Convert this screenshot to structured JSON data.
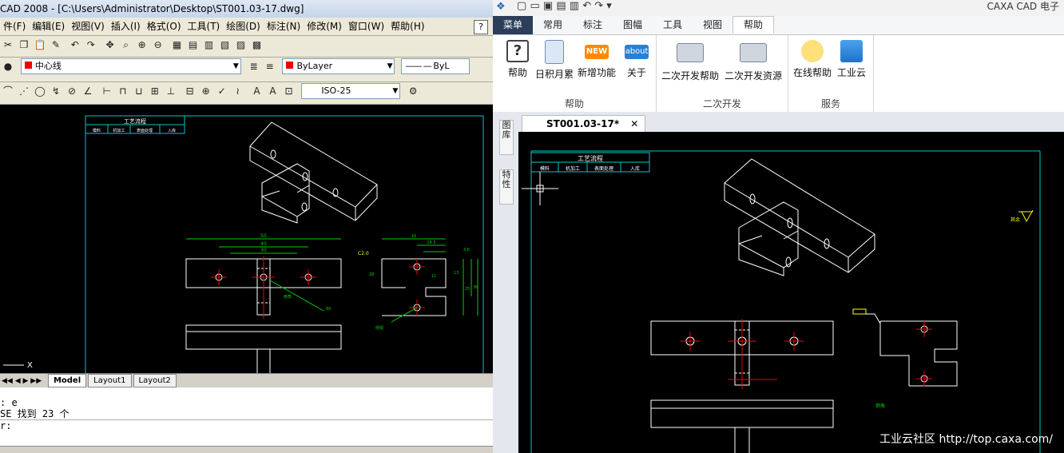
{
  "acad": {
    "title": "CAD 2008 - [C:\\Users\\Administrator\\Desktop\\ST001.03-17.dwg]",
    "menu": [
      "件(F)",
      "编辑(E)",
      "视图(V)",
      "插入(I)",
      "格式(O)",
      "工具(T)",
      "绘图(D)",
      "标注(N)",
      "修改(M)",
      "窗口(W)",
      "帮助(H)"
    ],
    "layer_value": "中心线",
    "color_value": "ByLayer",
    "linetype_value": "ByL",
    "dimstyle_value": "ISO-25",
    "layout_tabs": [
      "Model",
      "Layout1",
      "Layout2"
    ],
    "ucs_x": "X",
    "cmd_lines": [
      ": e",
      "SE 找到 23 个",
      "r:"
    ],
    "drawing": {
      "table_title": "工艺流程",
      "table_cells": [
        "模料",
        "机加工",
        "表面处理",
        "入库"
      ],
      "dims": [
        "50",
        "40",
        "30",
        "60",
        "16",
        "14.5",
        "C2.0",
        "28",
        "11",
        "13",
        "25",
        "36",
        "3.6"
      ],
      "notes": [
        "倒角",
        "侧视"
      ]
    }
  },
  "caxa": {
    "title": "CAXA CAD 电子",
    "ribbon_tabs": [
      "菜单",
      "常用",
      "标注",
      "图幅",
      "工具",
      "视图",
      "帮助"
    ],
    "active_tab": "帮助",
    "groups": [
      {
        "label": "帮助",
        "buttons": [
          "帮助",
          "日积月累",
          "新增功能",
          "关于"
        ]
      },
      {
        "label": "二次开发",
        "buttons": [
          "二次开发帮助",
          "二次开发资源"
        ]
      },
      {
        "label": "服务",
        "buttons": [
          "在线帮助",
          "工业云"
        ]
      }
    ],
    "icon_text": {
      "new": "NEW",
      "about": "about"
    },
    "side_tabs": [
      "图库",
      "特性"
    ],
    "doc_tab": "ST001.03-17*",
    "drawing": {
      "table_title": "工艺流程",
      "table_cells": [
        "模料",
        "机加工",
        "表面处理",
        "入库"
      ],
      "note": "倒角",
      "surface_mark": "其余"
    },
    "watermark": "工业云社区 http://top.caxa.com/"
  }
}
